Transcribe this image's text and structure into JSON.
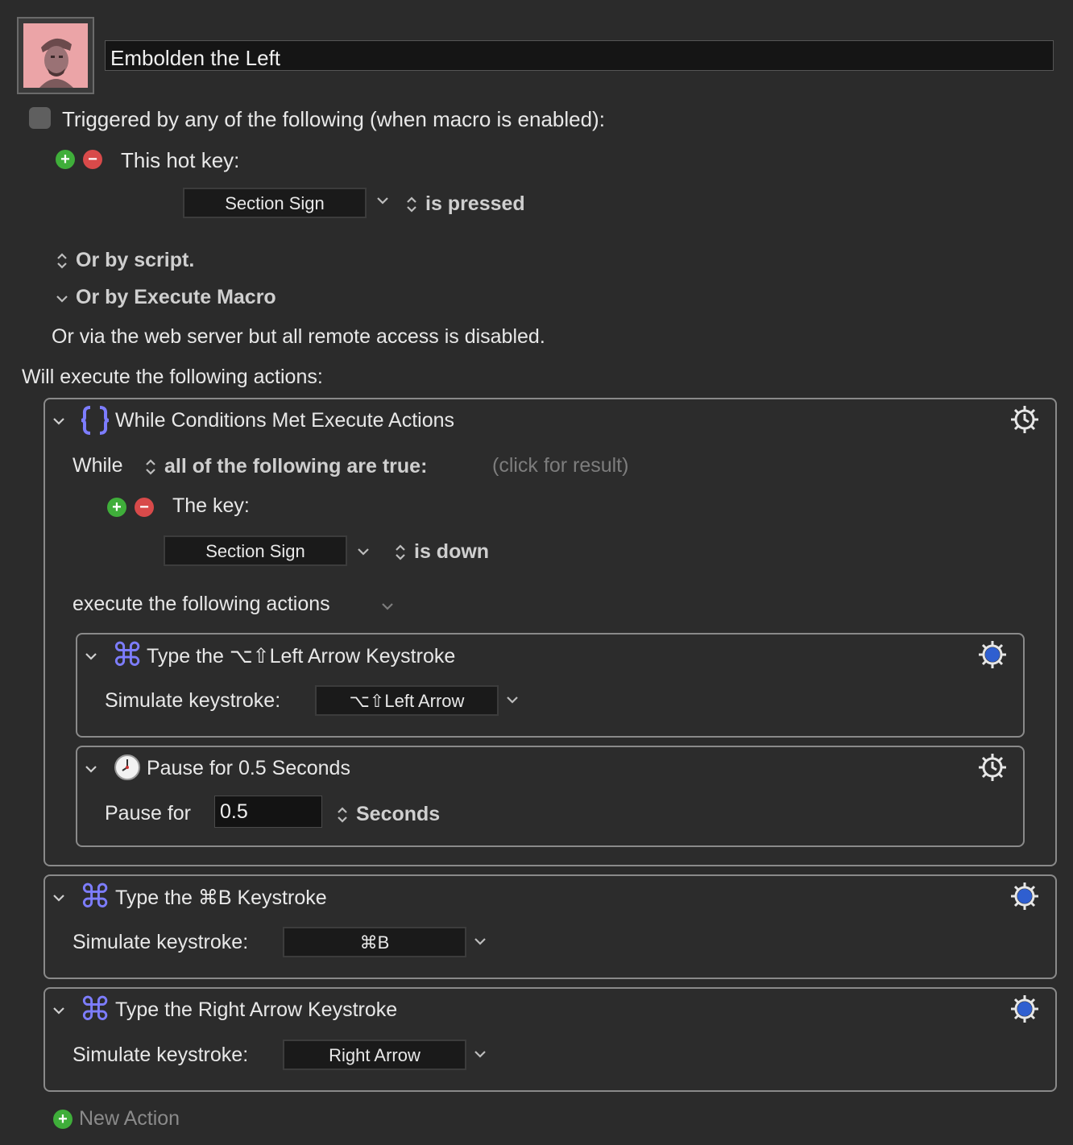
{
  "macro": {
    "name": "Embolden the Left"
  },
  "triggers": {
    "header": "Triggered by any of the following (when macro is enabled):",
    "hotkey_label": "This hot key:",
    "hotkey_value": "Section Sign",
    "hotkey_state": "is pressed",
    "or_script": "Or by script.",
    "or_execute_macro": "Or by Execute Macro",
    "web_server_note": "Or via the web server but all remote access is disabled."
  },
  "actions_header": "Will execute the following actions:",
  "while_action": {
    "title": "While Conditions Met Execute Actions",
    "while_label": "While",
    "condition_mode": "all of the following are true:",
    "click_result": "(click for result)",
    "key_label": "The key:",
    "key_value": "Section Sign",
    "key_state": "is down",
    "execute_label": "execute the following actions",
    "sub_actions": [
      {
        "title": "Type the ⌥⇧Left Arrow Keystroke",
        "simulate_label": "Simulate keystroke:",
        "keystroke": "⌥⇧Left Arrow"
      },
      {
        "title": "Pause for 0.5 Seconds",
        "pause_label": "Pause for",
        "pause_value": "0.5",
        "unit": "Seconds"
      }
    ]
  },
  "actions": [
    {
      "title": "Type the ⌘B Keystroke",
      "simulate_label": "Simulate keystroke:",
      "keystroke": "⌘B"
    },
    {
      "title": "Type the Right Arrow Keystroke",
      "simulate_label": "Simulate keystroke:",
      "keystroke": "Right Arrow"
    }
  ],
  "new_action": "New Action",
  "glyphs": {
    "cmd": "⌘",
    "braces": "{}",
    "chevron": "⌄",
    "updown": "⌃⌄"
  },
  "colors": {
    "accent": "#7d7dff",
    "add": "#3fae3a",
    "remove": "#d84a4a",
    "gear_active": "#2f5fd0"
  }
}
